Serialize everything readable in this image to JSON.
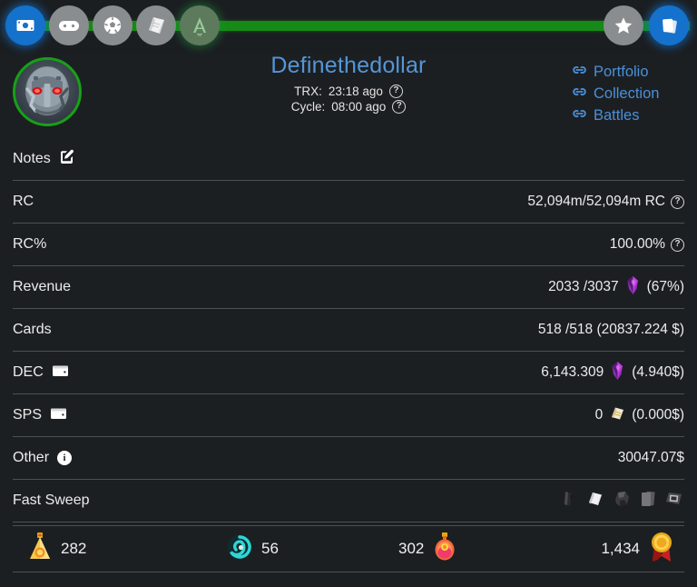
{
  "topnav": {
    "progress_percent": 100,
    "progress_color": "#168a16",
    "items": [
      {
        "name": "money-icon",
        "label": "Money",
        "state": "active"
      },
      {
        "name": "gamepad-icon",
        "label": "Gamepad",
        "state": "inactive"
      },
      {
        "name": "soccer-icon",
        "label": "Soccer",
        "state": "inactive"
      },
      {
        "name": "scroll-icon",
        "label": "Scroll",
        "state": "inactive"
      },
      {
        "name": "anvil-icon",
        "label": "Anvil",
        "state": "green"
      },
      {
        "name": "star-icon",
        "label": "Star",
        "state": "inactive"
      },
      {
        "name": "cards-icon",
        "label": "Cards",
        "state": "active"
      }
    ]
  },
  "header": {
    "avatar_name": "robot-avatar",
    "avatar_border_color": "#17a017",
    "title": "Definethedollar",
    "title_color": "#5596d8",
    "trx_label": "TRX:",
    "trx_value": "23:18 ago",
    "cycle_label": "Cycle:",
    "cycle_value": "08:00 ago",
    "help_glyph": "?",
    "links": [
      {
        "icon": "link-icon",
        "label": "Portfolio"
      },
      {
        "icon": "link-icon",
        "label": "Collection"
      },
      {
        "icon": "link-icon",
        "label": "Battles"
      }
    ],
    "link_color": "#4a90d9"
  },
  "rows": [
    {
      "label": "Notes",
      "label_icon": "edit-pencil-icon",
      "value": "",
      "value_icon": "",
      "help": false
    },
    {
      "label": "RC",
      "label_icon": "",
      "value": "52,094m/52,094m RC",
      "value_icon": "",
      "help": true
    },
    {
      "label": "RC%",
      "label_icon": "",
      "value": "100.00%",
      "value_icon": "",
      "help": true
    },
    {
      "label": "Revenue",
      "label_icon": "",
      "value_pre": "2033 /3037",
      "value_icon": "dec-crystal-icon",
      "value_post": "(67%)",
      "help": false
    },
    {
      "label": "Cards",
      "label_icon": "",
      "value": "518 /518 (20837.224 $)",
      "value_icon": "",
      "help": false
    },
    {
      "label": "DEC",
      "label_icon": "wallet-icon",
      "value_pre": "6,143.309",
      "value_icon": "dec-crystal-icon",
      "value_post": "(4.940$)",
      "help": false
    },
    {
      "label": "SPS",
      "label_icon": "wallet-icon",
      "value_pre": "0",
      "value_icon": "sps-scroll-icon",
      "value_post": "(0.000$)",
      "help": false
    },
    {
      "label": "Other",
      "label_icon": "info-icon",
      "value": "30047.07$",
      "value_icon": "",
      "help": false
    },
    {
      "label": "Fast Sweep",
      "label_icon": "",
      "value": "",
      "sweep_icons": [
        "sweep-dark-shard-icon",
        "sweep-scroll-icon",
        "sweep-rock-icon",
        "sweep-card-pack-icon",
        "sweep-frame-icon"
      ],
      "help": false
    }
  ],
  "footer": {
    "stats": [
      {
        "icon": "gold-potion-icon",
        "value": "282",
        "order": "icon-first"
      },
      {
        "icon": "teal-spiral-icon",
        "value": "56",
        "order": "icon-first"
      },
      {
        "icon": "red-potion-icon",
        "value": "302",
        "order": "value-first"
      },
      {
        "icon": "gold-medal-icon",
        "value": "1,434",
        "order": "value-first"
      }
    ]
  }
}
